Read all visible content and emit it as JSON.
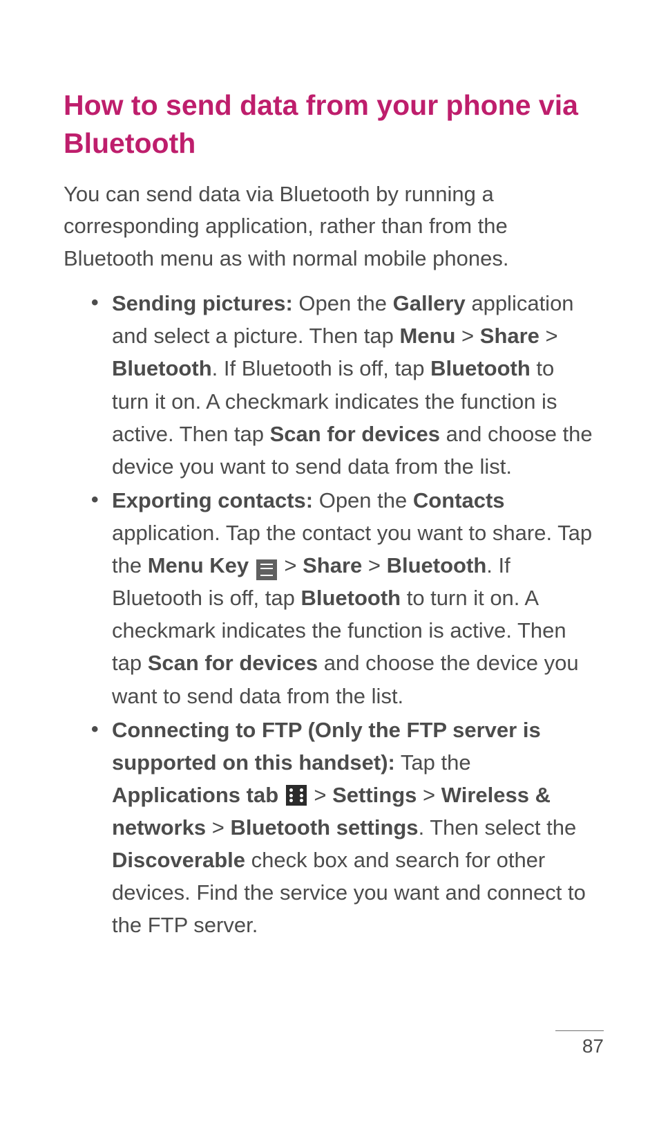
{
  "title": "How to send data from your phone via Bluetooth",
  "intro": "You can send data via Bluetooth by running a corresponding application, rather than from the Bluetooth menu as with normal mobile phones.",
  "bullets": [
    {
      "lead": "Sending pictures:",
      "t1": " Open the ",
      "b1": "Gallery",
      "t2": " application and select a picture. Then tap ",
      "b2": "Menu",
      "t3": " > ",
      "b3": "Share",
      "t4": " > ",
      "b4": "Bluetooth",
      "t5": ". If Bluetooth is off, tap ",
      "b5": "Bluetooth",
      "t6": " to turn it on. A checkmark indicates the function is active. Then tap ",
      "b6": "Scan for devices",
      "t7": " and choose the device you want to send data from the list."
    },
    {
      "lead": "Exporting contacts:",
      "t1": " Open the ",
      "b1": "Contacts",
      "t2": " application. Tap the contact you want to share. Tap the ",
      "b2": "Menu Key",
      "t3": " > ",
      "b3": "Share",
      "t4": " > ",
      "b4": "Bluetooth",
      "t5": ". If Bluetooth is off, tap ",
      "b5": "Bluetooth",
      "t6": " to turn it on. A checkmark indicates the function is active. Then tap ",
      "b6": "Scan for devices",
      "t7": " and choose the device you want to send data from the list."
    },
    {
      "lead": "Connecting to FTP (Only the FTP server is supported on this handset):",
      "t1": " Tap the ",
      "b1": "Applications tab",
      "t2": " > ",
      "b2": "Settings",
      "t3": " > ",
      "b3": "Wireless & networks",
      "t4": " > ",
      "b4": "Bluetooth settings",
      "t5": ". Then select the ",
      "b5": "Discoverable",
      "t6": " check box and search for other devices. Find the service you want and connect to the FTP server."
    }
  ],
  "page_number": "87"
}
